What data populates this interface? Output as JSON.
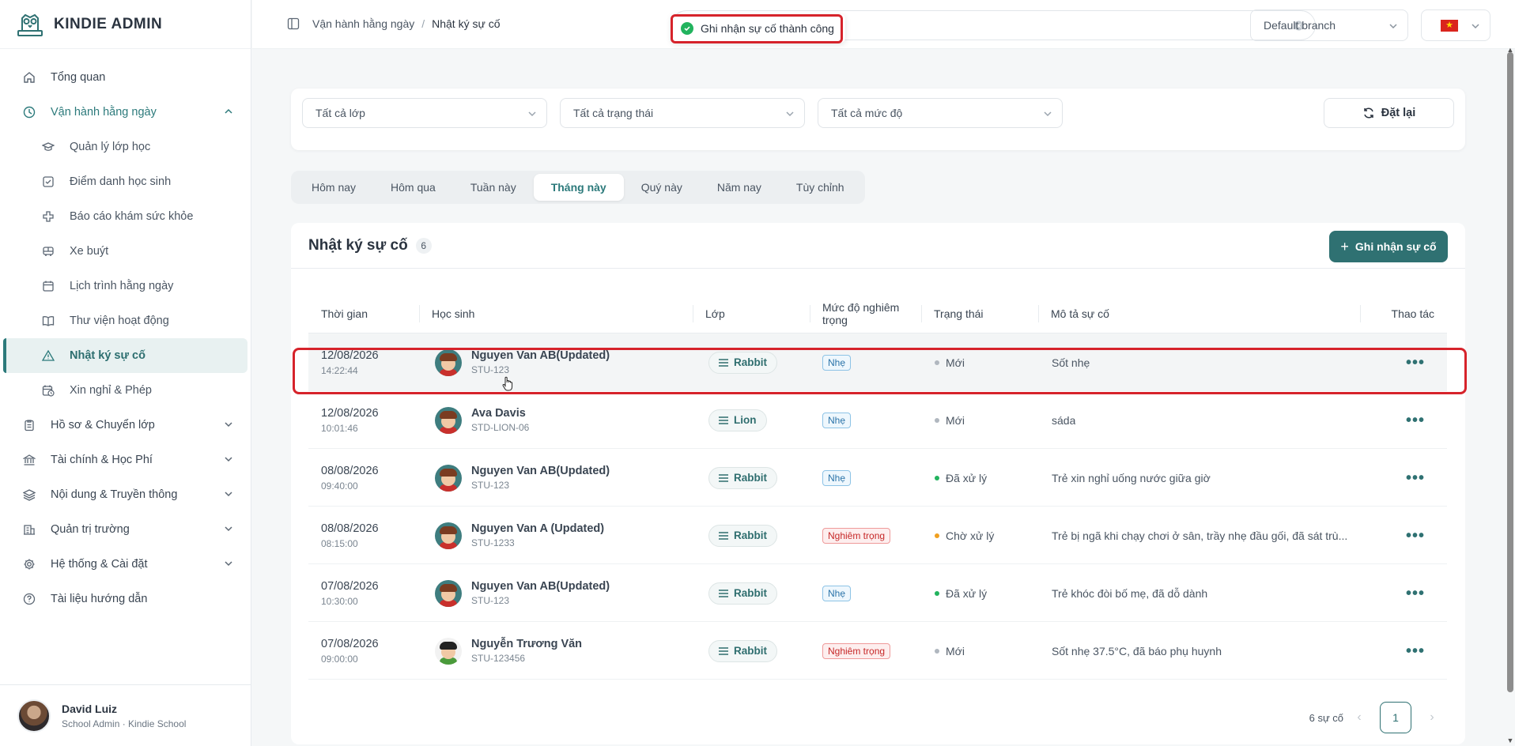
{
  "brand": {
    "name": "KINDIE ADMIN"
  },
  "sidebar": {
    "items": [
      {
        "label": "Tổng quan",
        "icon": "home-icon"
      },
      {
        "label": "Vận hành hằng ngày",
        "icon": "clock-icon"
      },
      {
        "label": "Hồ sơ & Chuyển lớp",
        "icon": "clipboard-icon"
      },
      {
        "label": "Tài chính & Học Phí",
        "icon": "bank-icon"
      },
      {
        "label": "Nội dung & Truyền thông",
        "icon": "layers-icon"
      },
      {
        "label": "Quản trị trường",
        "icon": "building-icon"
      },
      {
        "label": "Hệ thống & Cài đặt",
        "icon": "gear-icon"
      },
      {
        "label": "Tài liệu hướng dẫn",
        "icon": "help-icon"
      }
    ],
    "sub_items": [
      {
        "label": "Quản lý lớp học",
        "icon": "graduation-cap-icon"
      },
      {
        "label": "Điểm danh học sinh",
        "icon": "checkbox-icon"
      },
      {
        "label": "Báo cáo khám sức khỏe",
        "icon": "health-cross-icon"
      },
      {
        "label": "Xe buýt",
        "icon": "bus-icon"
      },
      {
        "label": "Lịch trình hằng ngày",
        "icon": "calendar-icon"
      },
      {
        "label": "Thư viện hoạt động",
        "icon": "book-icon"
      },
      {
        "label": "Nhật ký sự cố",
        "icon": "warning-icon"
      },
      {
        "label": "Xin nghỉ & Phép",
        "icon": "calendar-clock-icon"
      }
    ]
  },
  "user": {
    "name": "David Luiz",
    "role": "School Admin · Kindie School"
  },
  "header": {
    "breadcrumb": [
      "Vận hành hằng ngày",
      "Nhật ký sự cố"
    ],
    "toast": "Ghi nhận sự cố thành công",
    "branch": "Default branch",
    "flag_star": "★"
  },
  "filters": {
    "class": "Tất cả lớp",
    "status": "Tất cả trạng thái",
    "severity": "Tất cả mức độ",
    "reset": "Đặt lại"
  },
  "tabs": [
    "Hôm nay",
    "Hôm qua",
    "Tuần này",
    "Tháng này",
    "Quý này",
    "Năm nay",
    "Tùy chỉnh"
  ],
  "active_tab": "Tháng này",
  "table": {
    "title": "Nhật ký sự cố",
    "count": "6",
    "add_label": "Ghi nhận sự cố",
    "columns": [
      "Thời gian",
      "Học sinh",
      "Lớp",
      "Mức độ nghiêm trọng",
      "Trạng thái",
      "Mô tả sự cố",
      "Thao tác"
    ],
    "rows": [
      {
        "date": "12/08/2026",
        "time": "14:22:44",
        "name": "Nguyen Van AB(Updated)",
        "id": "STU-123",
        "class": "Rabbit",
        "severity": "Nhẹ",
        "status": "Mới",
        "desc": "Sốt nhẹ"
      },
      {
        "date": "12/08/2026",
        "time": "10:01:46",
        "name": "Ava Davis",
        "id": "STD-LION-06",
        "class": "Lion",
        "severity": "Nhẹ",
        "status": "Mới",
        "desc": "sáda"
      },
      {
        "date": "08/08/2026",
        "time": "09:40:00",
        "name": "Nguyen Van AB(Updated)",
        "id": "STU-123",
        "class": "Rabbit",
        "severity": "Nhẹ",
        "status": "Đã xử lý",
        "desc": "Trẻ xin nghỉ uống nước giữa giờ"
      },
      {
        "date": "08/08/2026",
        "time": "08:15:00",
        "name": "Nguyen Van A (Updated)",
        "id": "STU-1233",
        "class": "Rabbit",
        "severity": "Nghiêm trọng",
        "status": "Chờ xử lý",
        "desc": "Trẻ bị ngã khi chạy chơi ở sân, trầy nhẹ đầu gối, đã sát trù..."
      },
      {
        "date": "07/08/2026",
        "time": "10:30:00",
        "name": "Nguyen Van AB(Updated)",
        "id": "STU-123",
        "class": "Rabbit",
        "severity": "Nhẹ",
        "status": "Đã xử lý",
        "desc": "Trẻ khóc đòi bố mẹ, đã dỗ dành"
      },
      {
        "date": "07/08/2026",
        "time": "09:00:00",
        "name": "Nguyễn Trương Văn",
        "id": "STU-123456",
        "class": "Rabbit",
        "severity": "Nghiêm trọng",
        "status": "Mới",
        "desc": "Sốt nhẹ 37.5°C, đã báo phụ huynh"
      }
    ],
    "more_label": "•••"
  },
  "pagination": {
    "total": "6 sự cố",
    "page": "1",
    "prev": "‹",
    "next": "›"
  },
  "colors": {
    "accent": "#2f7172",
    "status_new": "#b0b7bf",
    "status_done": "#22b35e",
    "status_pending": "#f0a020",
    "highlight": "#d6232b"
  }
}
